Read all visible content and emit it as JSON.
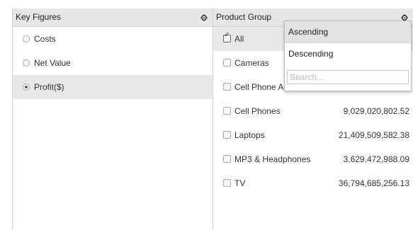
{
  "left_panel": {
    "title": "Key Figures",
    "gear_icon": "gear-icon",
    "options": [
      {
        "label": "Costs",
        "selected": false
      },
      {
        "label": "Net Value",
        "selected": false
      },
      {
        "label": "Profit($)",
        "selected": true
      }
    ]
  },
  "right_panel": {
    "title": "Product Group",
    "gear_icon": "gear-icon",
    "items": [
      {
        "label": "All",
        "checked": true,
        "value": ""
      },
      {
        "label": "Cameras",
        "checked": false,
        "value": ""
      },
      {
        "label": "Cell Phone Ac",
        "checked": false,
        "value": ""
      },
      {
        "label": "Cell Phones",
        "checked": false,
        "value": "9,029,020,802.52"
      },
      {
        "label": "Laptops",
        "checked": false,
        "value": "21,409,509,582.38"
      },
      {
        "label": "MP3 & Headphones",
        "checked": false,
        "value": "3,629,472,988.09"
      },
      {
        "label": "TV",
        "checked": false,
        "value": "36,794,685,256.13"
      }
    ]
  },
  "sort_popup": {
    "ascending_label": "Ascending",
    "descending_label": "Descending",
    "search_placeholder": "Search..."
  }
}
